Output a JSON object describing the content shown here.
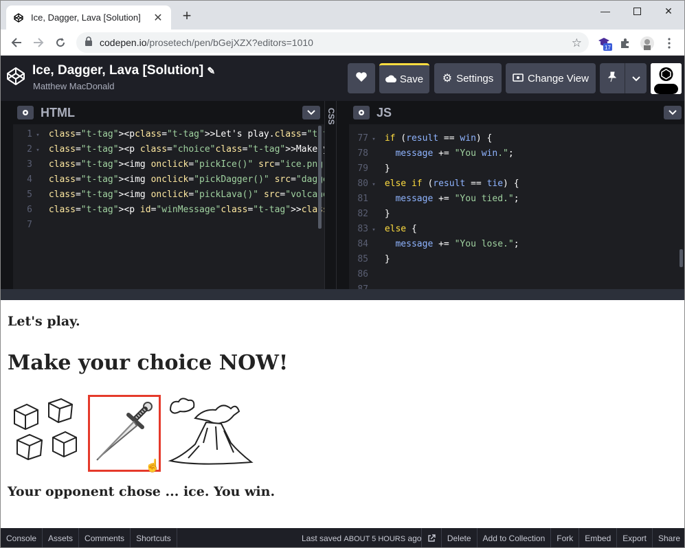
{
  "browser": {
    "tab_title": "Ice, Dagger, Lava [Solution]",
    "url_host": "codepen.io",
    "url_path": "/prosetech/pen/bGejXZX?editors=1010",
    "ext_badge": "17"
  },
  "header": {
    "pen_title": "Ice, Dagger, Lava [Solution]",
    "author": "Matthew MacDonald",
    "save_label": "Save",
    "settings_label": "Settings",
    "change_view_label": "Change View"
  },
  "html_pane": {
    "title": "HTML",
    "line_numbers": [
      "1",
      "2",
      "3",
      "4",
      "5",
      "6",
      "7"
    ],
    "lines": [
      "<p>Let's play.</p>",
      "<p class=\"choice\">Make your choice NOW!</p>",
      "<img onclick=\"pickIce()\" src=\"ice.png\">",
      "<img onclick=\"pickDagger()\" src=\"dagger.png\">",
      "<img onclick=\"pickLava()\" src=\"volcano.png\">",
      "<p id=\"winMessage\"></p>",
      ""
    ]
  },
  "css_pane": {
    "title": "CSS"
  },
  "js_pane": {
    "title": "JS",
    "line_numbers": [
      "77",
      "78",
      "79",
      "80",
      "81",
      "82",
      "83",
      "84",
      "85",
      "86",
      "87"
    ],
    "lines": [
      "if (result == win) {",
      "  message += \"You win.\";",
      "}",
      "else if (result == tie) {",
      "  message += \"You tied.\";",
      "}",
      "else {",
      "  message += \"You lose.\";",
      "}",
      "",
      ""
    ]
  },
  "preview": {
    "line1": "Let's play.",
    "line2": "Make your choice NOW!",
    "result": "Your opponent chose ... ice. You win.",
    "choices": [
      "ice",
      "dagger",
      "volcano"
    ],
    "selected": "dagger"
  },
  "footer": {
    "console": "Console",
    "assets": "Assets",
    "comments": "Comments",
    "shortcuts": "Shortcuts",
    "saved_prefix": "Last saved",
    "saved_time": "ABOUT 5 HOURS",
    "saved_suffix": "ago",
    "delete": "Delete",
    "add_to_collection": "Add to Collection",
    "fork": "Fork",
    "embed": "Embed",
    "export": "Export",
    "share": "Share"
  },
  "colors": {
    "accent_save": "#ffdd40",
    "selection": "#e53a2b",
    "editor_bg": "#1d1e22"
  }
}
